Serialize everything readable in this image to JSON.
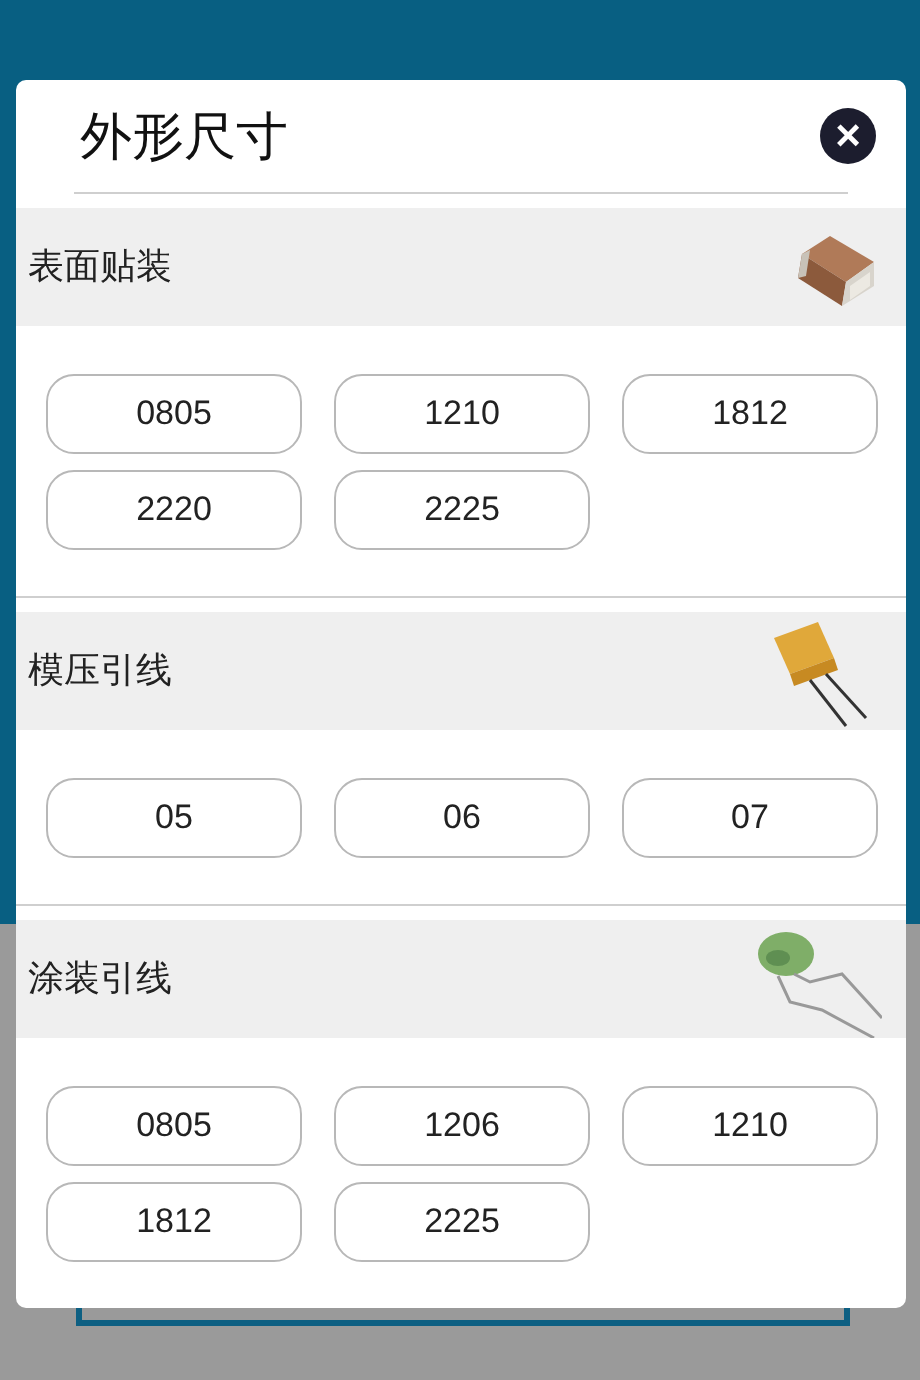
{
  "dialog": {
    "title": "外形尺寸",
    "close": "×"
  },
  "sections": [
    {
      "title": "表面贴装",
      "kind": "chip",
      "options": [
        "0805",
        "1210",
        "1812",
        "2220",
        "2225"
      ]
    },
    {
      "title": "模压引线",
      "kind": "molded",
      "options": [
        "05",
        "06",
        "07"
      ]
    },
    {
      "title": "涂装引线",
      "kind": "coated",
      "options": [
        "0805",
        "1206",
        "1210",
        "1812",
        "2225"
      ]
    }
  ]
}
